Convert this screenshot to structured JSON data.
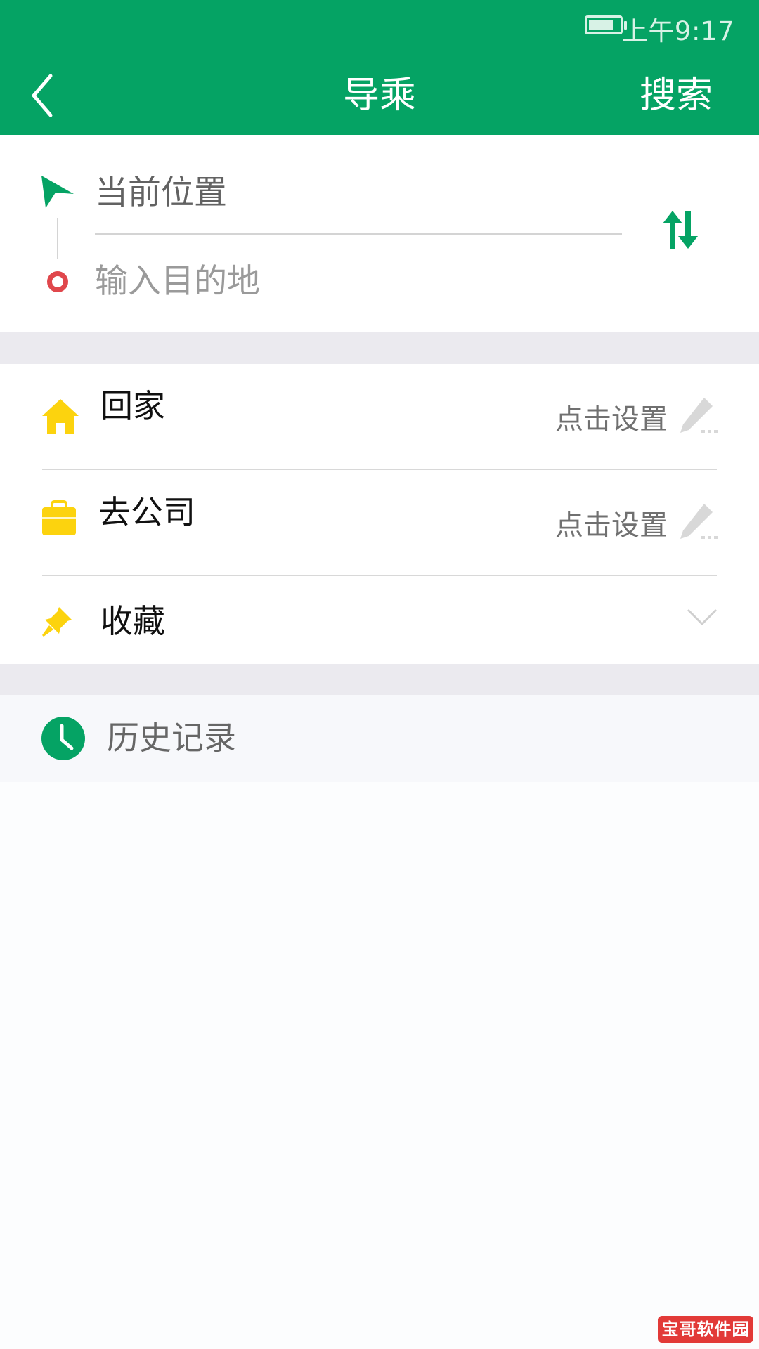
{
  "status_bar": {
    "time": "上午9:17",
    "battery_icon": "battery-charging-icon"
  },
  "header": {
    "back_icon": "chevron-left-icon",
    "title": "导乘",
    "search_label": "搜索"
  },
  "route": {
    "origin_value": "当前位置",
    "destination_placeholder": "输入目的地",
    "swap_icon": "swap-vertical-icon"
  },
  "places": [
    {
      "label": "回家",
      "action": "点击设置",
      "icon": "home-icon"
    },
    {
      "label": "去公司",
      "action": "点击设置",
      "icon": "briefcase-icon"
    },
    {
      "label": "收藏",
      "icon": "pin-icon"
    }
  ],
  "history": {
    "label": "历史记录",
    "icon": "clock-icon"
  },
  "watermark": {
    "text": "宝哥软件园"
  },
  "colors": {
    "brand_green": "#05a364",
    "home_yellow": "#fcd30e",
    "destination_red": "#e0474c"
  }
}
